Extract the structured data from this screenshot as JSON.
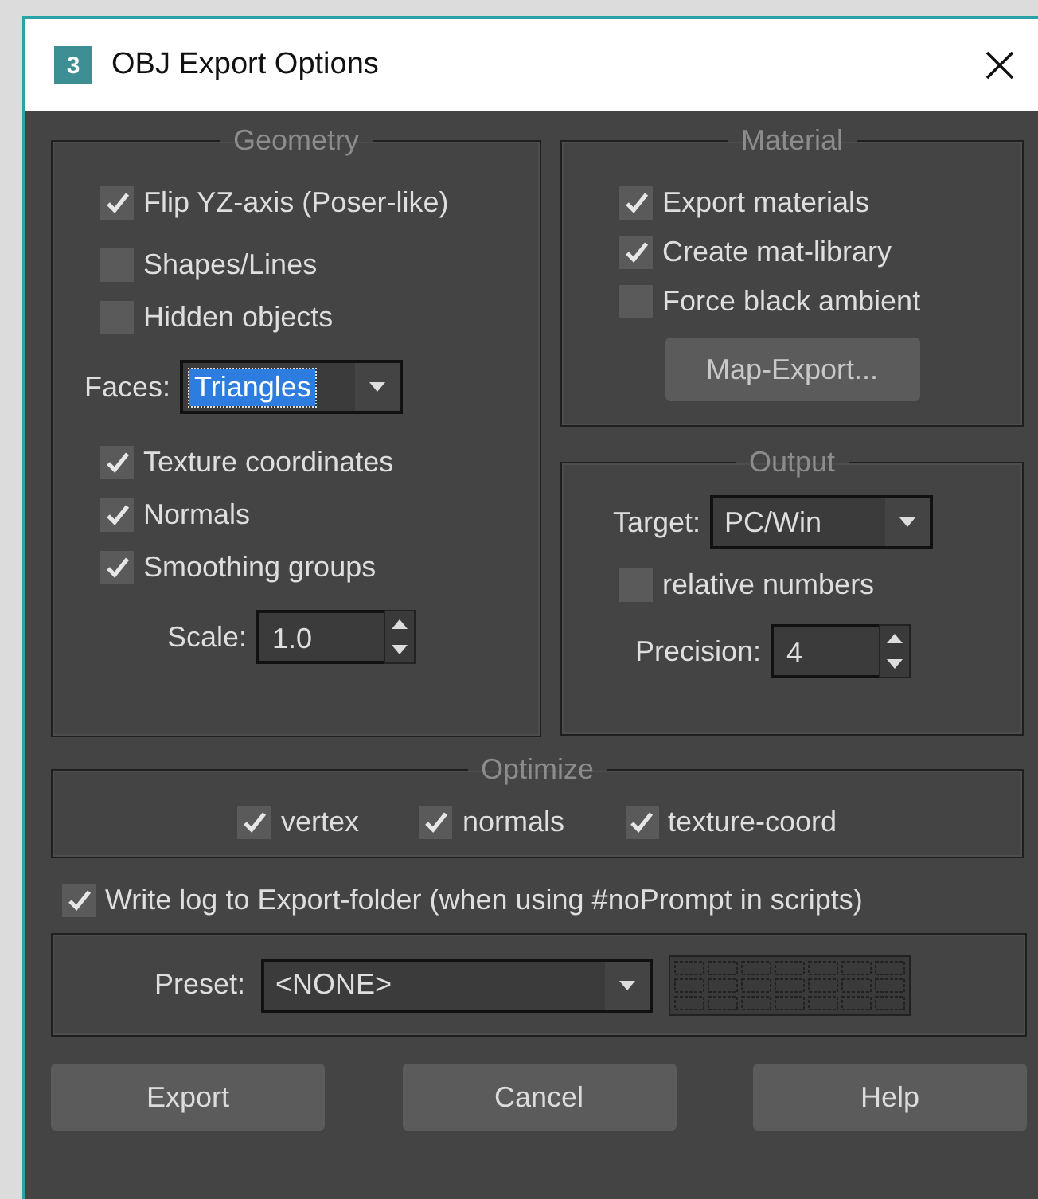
{
  "window": {
    "title": "OBJ Export Options",
    "app_icon": "3"
  },
  "geometry": {
    "title": "Geometry",
    "items": [
      {
        "kind": "checkbox",
        "label": "Flip YZ-axis (Poser-like)",
        "checked": true
      },
      {
        "kind": "checkbox",
        "label": "Shapes/Lines",
        "checked": false
      },
      {
        "kind": "checkbox",
        "label": "Hidden objects",
        "checked": false
      },
      {
        "kind": "dropdown",
        "label": "Faces:",
        "value": "Triangles",
        "focused": true
      },
      {
        "kind": "checkbox",
        "label": "Texture coordinates",
        "checked": true
      },
      {
        "kind": "checkbox",
        "label": "Normals",
        "checked": true
      },
      {
        "kind": "checkbox",
        "label": "Smoothing groups",
        "checked": true
      },
      {
        "kind": "spinner",
        "label": "Scale:",
        "value": "1.0"
      }
    ]
  },
  "material": {
    "title": "Material",
    "items": [
      {
        "kind": "checkbox",
        "label": "Export materials",
        "checked": true
      },
      {
        "kind": "checkbox",
        "label": "Create mat-library",
        "checked": true
      },
      {
        "kind": "checkbox",
        "label": "Force black ambient",
        "checked": false
      },
      {
        "kind": "button",
        "label": "Map-Export..."
      }
    ]
  },
  "output": {
    "title": "Output",
    "items": [
      {
        "kind": "dropdown",
        "label": "Target:",
        "value": "PC/Win",
        "focused": false
      },
      {
        "kind": "checkbox",
        "label": "relative numbers",
        "checked": false
      },
      {
        "kind": "spinner",
        "label": "Precision:",
        "value": "4"
      }
    ]
  },
  "optimize": {
    "title": "Optimize",
    "items": [
      {
        "label": "vertex",
        "checked": true
      },
      {
        "label": "normals",
        "checked": true
      },
      {
        "label": "texture-coord",
        "checked": true
      }
    ]
  },
  "write_log": {
    "label": "Write log to Export-folder (when using #noPrompt in scripts)",
    "checked": true
  },
  "preset": {
    "label": "Preset:",
    "value": "<NONE>"
  },
  "buttons": [
    "Export",
    "Cancel",
    "Help"
  ]
}
